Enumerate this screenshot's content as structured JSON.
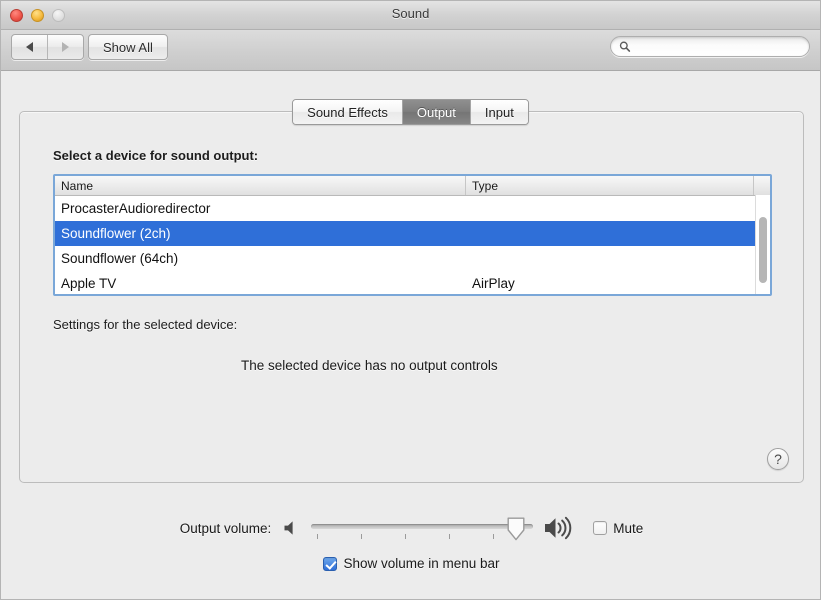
{
  "window": {
    "title": "Sound",
    "traffic_lights": [
      "close",
      "minimize",
      "zoom"
    ]
  },
  "toolbar": {
    "back_label": "Back",
    "forward_label": "Forward",
    "show_all_label": "Show All",
    "search": {
      "value": "",
      "placeholder": ""
    }
  },
  "tabs": [
    {
      "label": "Sound Effects",
      "selected": false
    },
    {
      "label": "Output",
      "selected": true
    },
    {
      "label": "Input",
      "selected": false
    }
  ],
  "main": {
    "section_label": "Select a device for sound output:",
    "table": {
      "columns": [
        "Name",
        "Type"
      ],
      "rows": [
        {
          "name": "ProcasterAudioredirector",
          "type": "",
          "selected": false
        },
        {
          "name": "Soundflower (2ch)",
          "type": "",
          "selected": true
        },
        {
          "name": "Soundflower (64ch)",
          "type": "",
          "selected": false
        },
        {
          "name": "Apple TV",
          "type": "AirPlay",
          "selected": false
        }
      ]
    },
    "settings_label": "Settings for the selected device:",
    "no_controls_message": "The selected device has no output controls",
    "help_label": "?"
  },
  "footer": {
    "volume_label": "Output volume:",
    "volume_percent": 92,
    "mute_label": "Mute",
    "mute_checked": false,
    "show_volume_label": "Show volume in menu bar",
    "show_volume_checked": true
  },
  "colors": {
    "selection_blue": "#2f6fd8",
    "window_bg": "#ececec",
    "table_border": "#7aa7d8"
  }
}
